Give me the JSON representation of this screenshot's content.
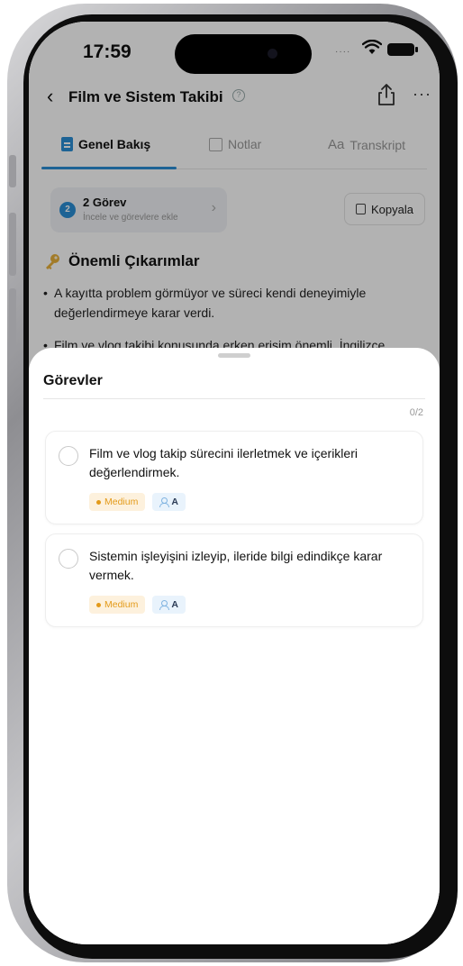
{
  "status_bar": {
    "time": "17:59"
  },
  "nav": {
    "title": "Film ve Sistem Takibi"
  },
  "tabs": [
    {
      "label": "Genel Bakış",
      "active": true,
      "icon": "document-icon"
    },
    {
      "label": "Notlar",
      "active": false,
      "icon": "note-edit-icon"
    },
    {
      "label": "Transkript",
      "active": false,
      "icon": "text-size-icon"
    }
  ],
  "tasks_card": {
    "count": "2",
    "title": "2 Görev",
    "subtitle": "İncele ve görevlere ekle"
  },
  "copy_button": {
    "label": "Kopyala"
  },
  "section": {
    "title": "Önemli Çıkarımlar"
  },
  "bullets": [
    "A kayıtta problem görmüyor ve süreci kendi deneyimiyle değerlendirmeye karar verdi.",
    "Film ve vlog takibi konusunda erken erişim önemli. İngilizce"
  ],
  "sheet": {
    "title": "Görevler",
    "count": "0/2",
    "items": [
      {
        "text": "Film ve vlog takip sürecini ilerletmek ve içerikleri değerlendirmek.",
        "priority": "Medium",
        "assignee": "A",
        "checked": false
      },
      {
        "text": "Sistemin işleyişini izleyip, ileride bilgi edindikçe karar vermek.",
        "priority": "Medium",
        "assignee": "A",
        "checked": false
      }
    ]
  },
  "colors": {
    "accent": "#2a8fd6",
    "priority_bg": "#fdf1dd",
    "priority_fg": "#e39a19"
  }
}
